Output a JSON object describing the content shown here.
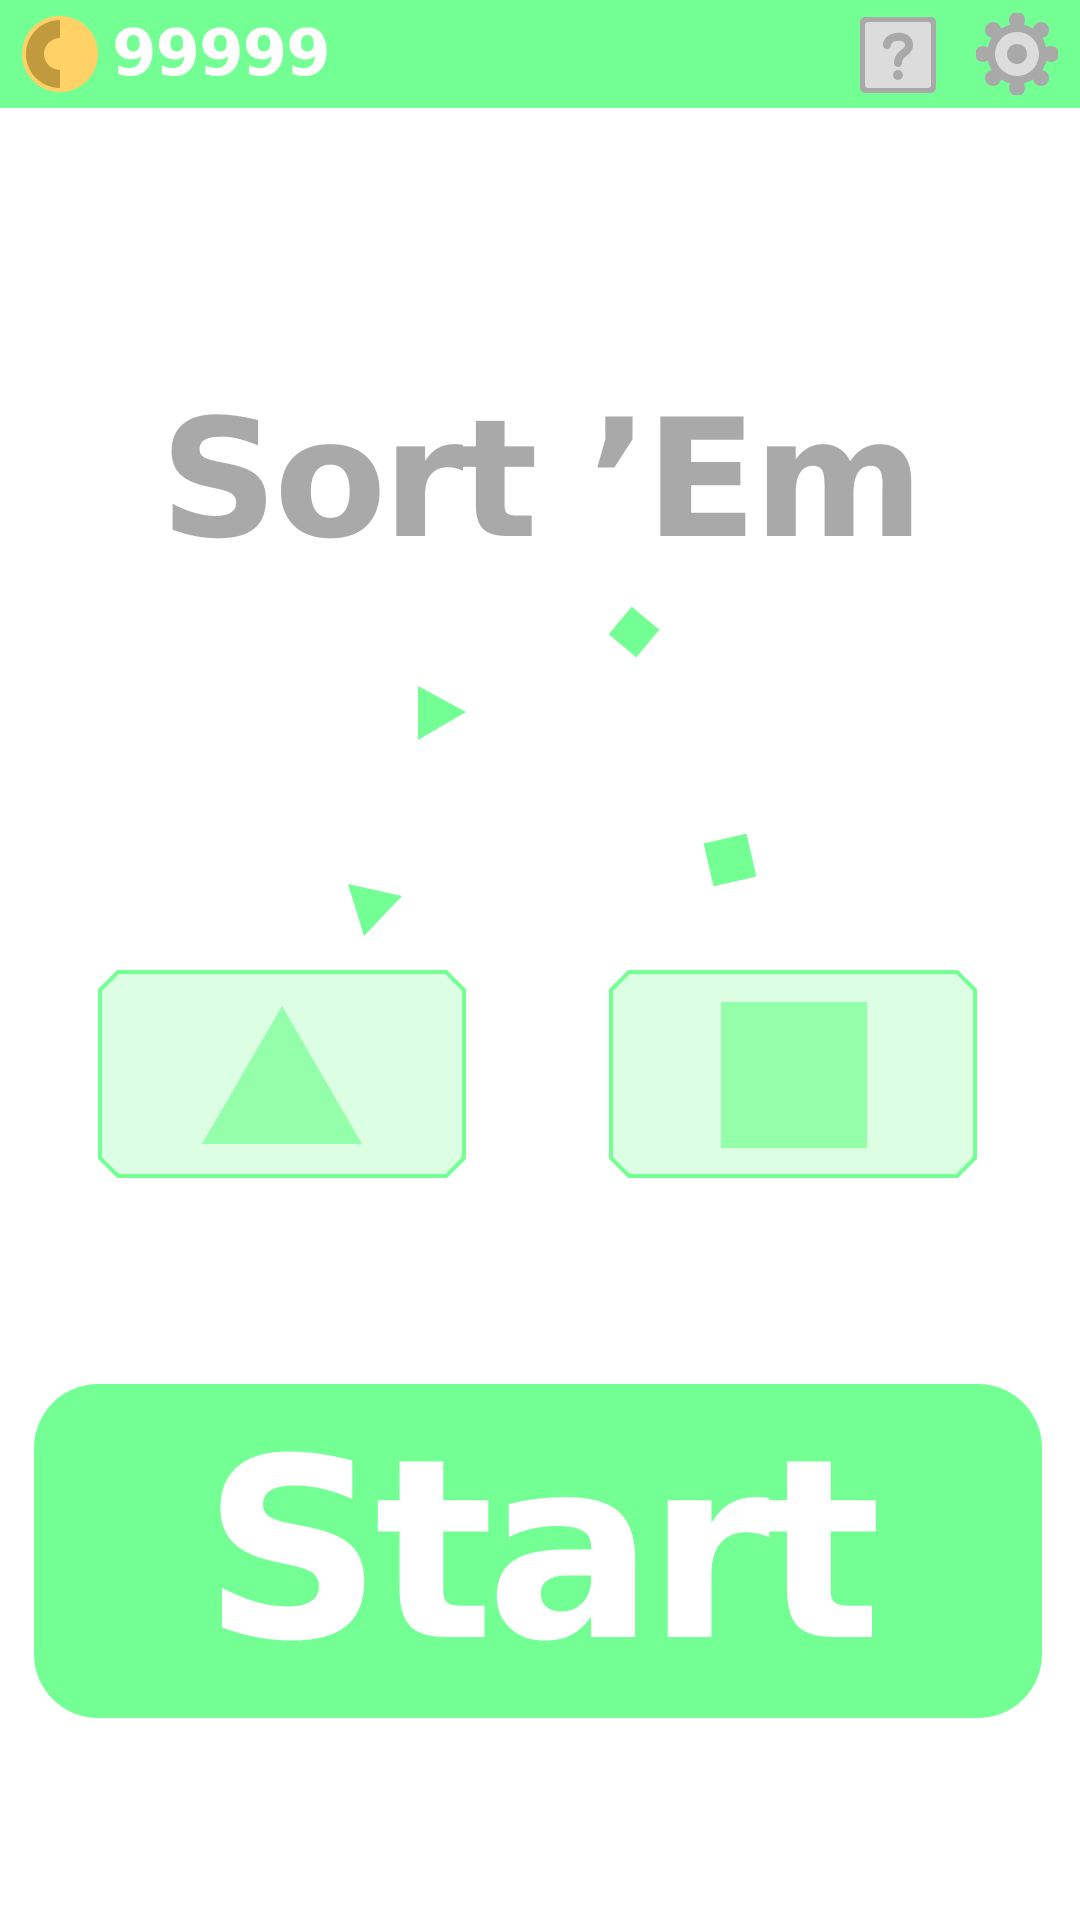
{
  "hud": {
    "coin_count": "99999",
    "coin_icon": "coin-icon",
    "help_icon": "question-mark-icon",
    "settings_icon": "gear-icon"
  },
  "title": "Sort ’Em",
  "falling_shapes": [
    {
      "kind": "square",
      "icon": "square-shape-icon"
    },
    {
      "kind": "triangle",
      "icon": "triangle-shape-icon"
    },
    {
      "kind": "square",
      "icon": "square-shape-icon"
    },
    {
      "kind": "triangle",
      "icon": "triangle-shape-icon"
    }
  ],
  "bins": [
    {
      "shape": "triangle",
      "icon": "triangle-icon"
    },
    {
      "shape": "square",
      "icon": "square-icon"
    }
  ],
  "start_button": {
    "label": "Start"
  },
  "colors": {
    "accent": "#74ff94",
    "shape_fill": "#93ffaa",
    "bin_fill": "#dcffe3",
    "title_gray": "#a9a9a9",
    "icon_gray": "#a9a9a9",
    "coin_gold": "#ffd166",
    "coin_dark": "#c09a3c"
  }
}
